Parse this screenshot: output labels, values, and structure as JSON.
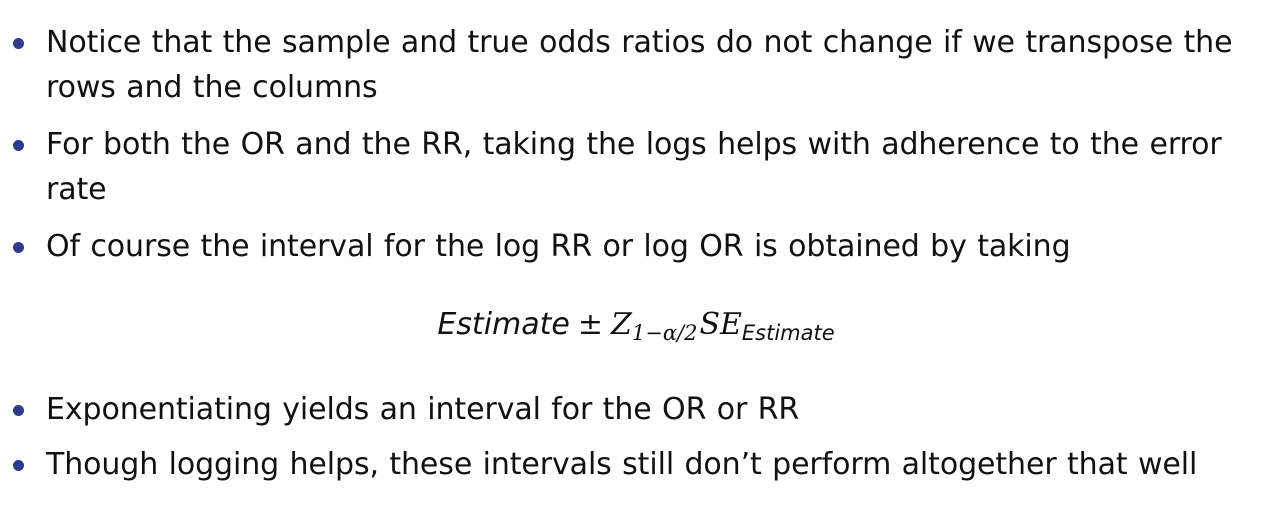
{
  "bullets": [
    {
      "text": "Notice that the sample and true odds ratios do not change if we transpose the rows and the columns"
    },
    {
      "text": "For both the OR and the RR, taking the logs helps with adherence to the error rate"
    },
    {
      "text": "Of course the interval for the log RR or log OR is obtained by taking"
    },
    {
      "text": "Exponentiating yields an interval for the OR or RR"
    },
    {
      "text": "Though logging helps, these intervals still don’t perform altogether that well"
    }
  ],
  "formula": {
    "estimate": "Estimate",
    "plus_minus": "±",
    "z": "Z",
    "z_subscript": "1−α/2",
    "se": "SE",
    "se_subscript": "Estimate"
  },
  "colors": {
    "bullet": "#2f3a8f",
    "text": "#111111",
    "background": "#ffffff"
  }
}
